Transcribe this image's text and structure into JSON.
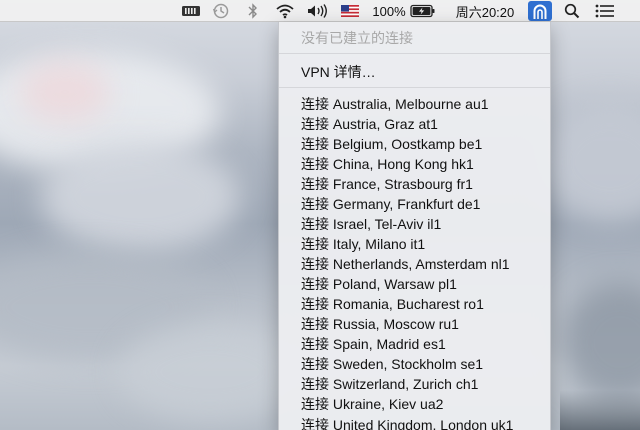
{
  "menubar": {
    "battery_percent": "100%",
    "clock": "周六20:20"
  },
  "menu": {
    "status": "没有已建立的连接",
    "vpn_details": "VPN 详情…",
    "connections": [
      "连接 Australia, Melbourne au1",
      "连接 Austria, Graz at1",
      "连接 Belgium, Oostkamp be1",
      "连接 China, Hong Kong hk1",
      "连接 France, Strasbourg fr1",
      "连接 Germany, Frankfurt de1",
      "连接 Israel, Tel-Aviv il1",
      "连接 Italy, Milano it1",
      "连接 Netherlands, Amsterdam nl1",
      "连接 Poland, Warsaw pl1",
      "连接 Romania, Bucharest ro1",
      "连接 Russia, Moscow ru1",
      "连接 Spain, Madrid es1",
      "连接 Sweden, Stockholm se1",
      "连接 Switzerland, Zurich ch1",
      "连接 Ukraine, Kiev ua2",
      "连接 United Kingdom, London uk1"
    ]
  },
  "icons": [
    "memory-icon",
    "time-machine-icon",
    "bluetooth-icon",
    "wifi-icon",
    "volume-icon",
    "us-flag-icon",
    "battery-charging-icon",
    "vpn-icon",
    "spotlight-search-icon",
    "notification-center-icon"
  ],
  "colors": {
    "vpn_active": "#2f6fd0",
    "disabled_text": "#a8a8a8"
  }
}
